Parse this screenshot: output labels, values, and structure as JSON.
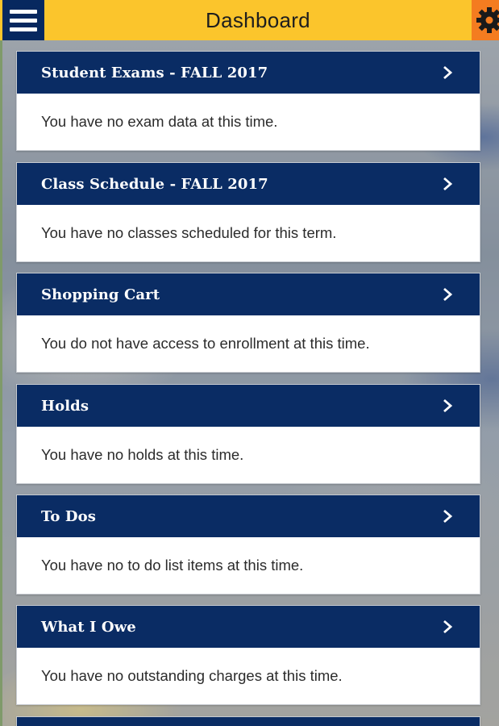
{
  "header": {
    "title": "Dashboard",
    "menu_icon": "hamburger-menu-icon",
    "settings_icon": "gear-icon"
  },
  "colors": {
    "header_bg": "#fbc52c",
    "menu_bg": "#07285f",
    "settings_bg": "#f47c20",
    "card_header_bg": "#0a2c64"
  },
  "cards": [
    {
      "title": "Student Exams - FALL 2017",
      "message": "You have no exam data at this time."
    },
    {
      "title": "Class Schedule - FALL 2017",
      "message": "You have no classes scheduled for this term."
    },
    {
      "title": "Shopping Cart",
      "message": "You do not have access to enrollment at this time."
    },
    {
      "title": "Holds",
      "message": "You have no holds at this time."
    },
    {
      "title": "To Dos",
      "message": "You have no to do list items at this time."
    },
    {
      "title": "What I Owe",
      "message": "You have no outstanding charges at this time."
    }
  ]
}
